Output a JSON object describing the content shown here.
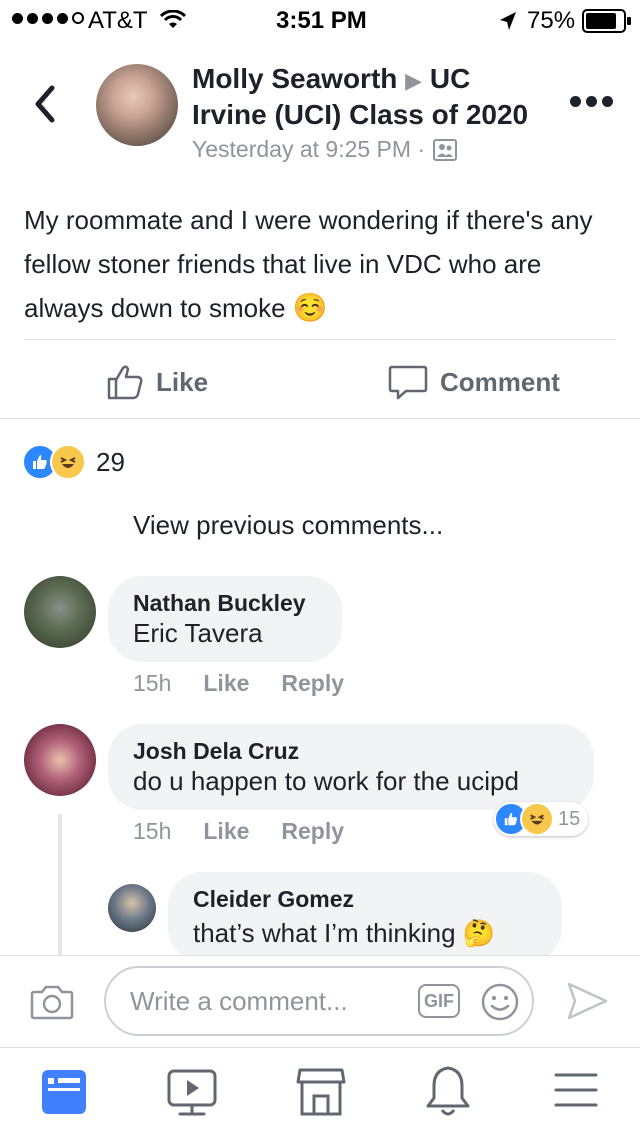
{
  "status": {
    "carrier": "AT&T",
    "time": "3:51 PM",
    "battery": "75%"
  },
  "post": {
    "author": "Molly Seaworth",
    "group": "UC Irvine (UCI) Class of 2020",
    "timestamp": "Yesterday at 9:25 PM ·",
    "text": "My roommate and I were wondering if there's any fellow stoner friends that live in VDC who are always down to smoke",
    "emoji": "☺️"
  },
  "actions": {
    "like": "Like",
    "comment": "Comment"
  },
  "reactions": {
    "count": "29"
  },
  "view_previous": "View previous comments...",
  "comments": [
    {
      "name": "Nathan Buckley",
      "text": "Eric Tavera",
      "time": "15h",
      "like": "Like",
      "reply": "Reply"
    },
    {
      "name": "Josh Dela Cruz",
      "text": "do u happen to work for the ucipd",
      "time": "15h",
      "like": "Like",
      "reply": "Reply",
      "reaction_count": "15"
    },
    {
      "name": "Cleider Gomez",
      "text": "that’s what I’m thinking",
      "emoji": "🤔"
    }
  ],
  "composer": {
    "placeholder": "Write a comment...",
    "gif": "GIF"
  },
  "icons": {
    "back": "chevron-left-icon",
    "more": "more-icon",
    "like": "thumbs-up-icon",
    "comment": "comment-icon",
    "camera": "camera-icon",
    "sticker": "smiley-icon",
    "send": "send-icon",
    "tabs": [
      "news-feed-icon",
      "video-icon",
      "marketplace-icon",
      "notifications-icon",
      "menu-icon"
    ]
  },
  "colors": {
    "accent": "#4080ff",
    "like": "#2d88ff",
    "haha": "#f7c84b"
  }
}
